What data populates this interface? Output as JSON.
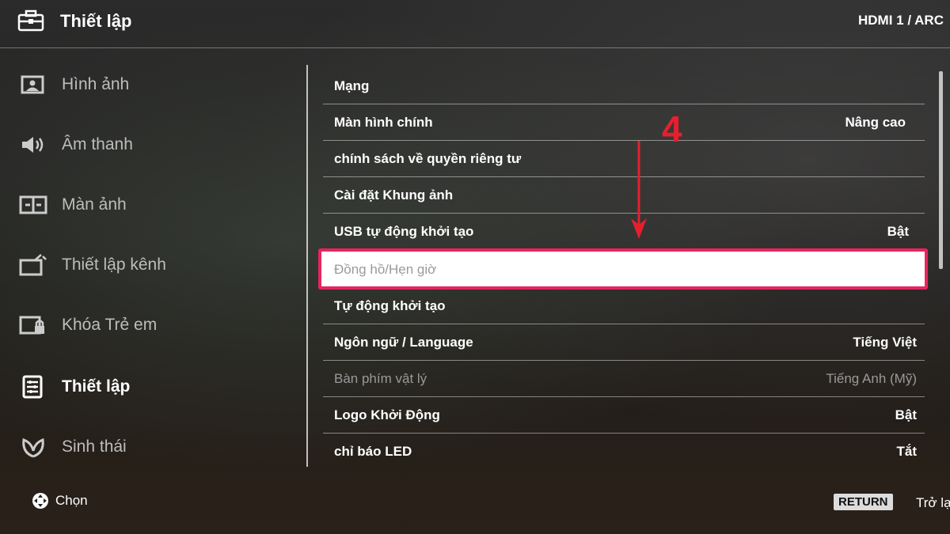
{
  "header": {
    "title": "Thiết lập",
    "source": "HDMI 1 / ARC"
  },
  "sidebar": {
    "items": [
      {
        "label": "Hình ảnh",
        "icon": "picture-icon"
      },
      {
        "label": "Âm thanh",
        "icon": "speaker-icon"
      },
      {
        "label": "Màn ảnh",
        "icon": "screen-icon"
      },
      {
        "label": "Thiết lập kênh",
        "icon": "channel-icon"
      },
      {
        "label": "Khóa Trẻ em",
        "icon": "child-lock-icon"
      },
      {
        "label": "Thiết lập",
        "icon": "settings-icon",
        "active": true
      },
      {
        "label": "Sinh thái",
        "icon": "eco-icon"
      }
    ]
  },
  "settings": {
    "rows": [
      {
        "name": "Mạng",
        "value": ""
      },
      {
        "name": "Màn hình chính",
        "value": "Nâng cao"
      },
      {
        "name": "chính sách về quyền riêng tư",
        "value": ""
      },
      {
        "name": "Cài đặt Khung ảnh",
        "value": ""
      },
      {
        "name": "USB tự động khởi tạo",
        "value": "Bật"
      },
      {
        "name": "Đồng hồ/Hẹn giờ",
        "value": "",
        "selected": true
      },
      {
        "name": "Tự động khởi tạo",
        "value": ""
      },
      {
        "name": "Ngôn ngữ / Language",
        "value": "Tiếng Việt"
      },
      {
        "name": "Bàn phím vật lý",
        "value": "Tiếng Anh (Mỹ)",
        "disabled": true
      },
      {
        "name": "Logo Khởi Động",
        "value": "Bật"
      },
      {
        "name": "chỉ báo LED",
        "value": "Tắt"
      }
    ]
  },
  "annotation": {
    "step_number": "4",
    "color": "#e61f2f",
    "highlight_color": "#e8245e"
  },
  "footer": {
    "select_label": "Chọn",
    "return_label": "RETURN",
    "back_label": "Trở lại"
  }
}
